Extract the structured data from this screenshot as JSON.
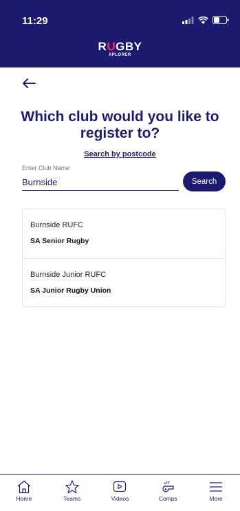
{
  "status_bar": {
    "time": "11:29"
  },
  "brand": {
    "logo_prefix": "R",
    "logo_highlight": "U",
    "logo_suffix": "GBY",
    "logo_sub": "XPLORER"
  },
  "page": {
    "title": "Which club would you like to register to?",
    "postcode_link": "Search by postcode",
    "field_label": "Enter Club Name",
    "search_value": "Burnside",
    "search_button": "Search"
  },
  "results": [
    {
      "name": "Burnside RUFC",
      "competition": "SA Senior Rugby"
    },
    {
      "name": "Burnside Junior RUFC",
      "competition": "SA Junior Rugby Union"
    }
  ],
  "tabbar": [
    {
      "label": "Home",
      "icon": "home-icon"
    },
    {
      "label": "Teams",
      "icon": "star-icon"
    },
    {
      "label": "Videos",
      "icon": "play-icon"
    },
    {
      "label": "Comps",
      "icon": "whistle-icon"
    },
    {
      "label": "More",
      "icon": "menu-icon"
    }
  ],
  "colors": {
    "navy": "#1c1a6e",
    "accent": "#ff2a6d"
  }
}
